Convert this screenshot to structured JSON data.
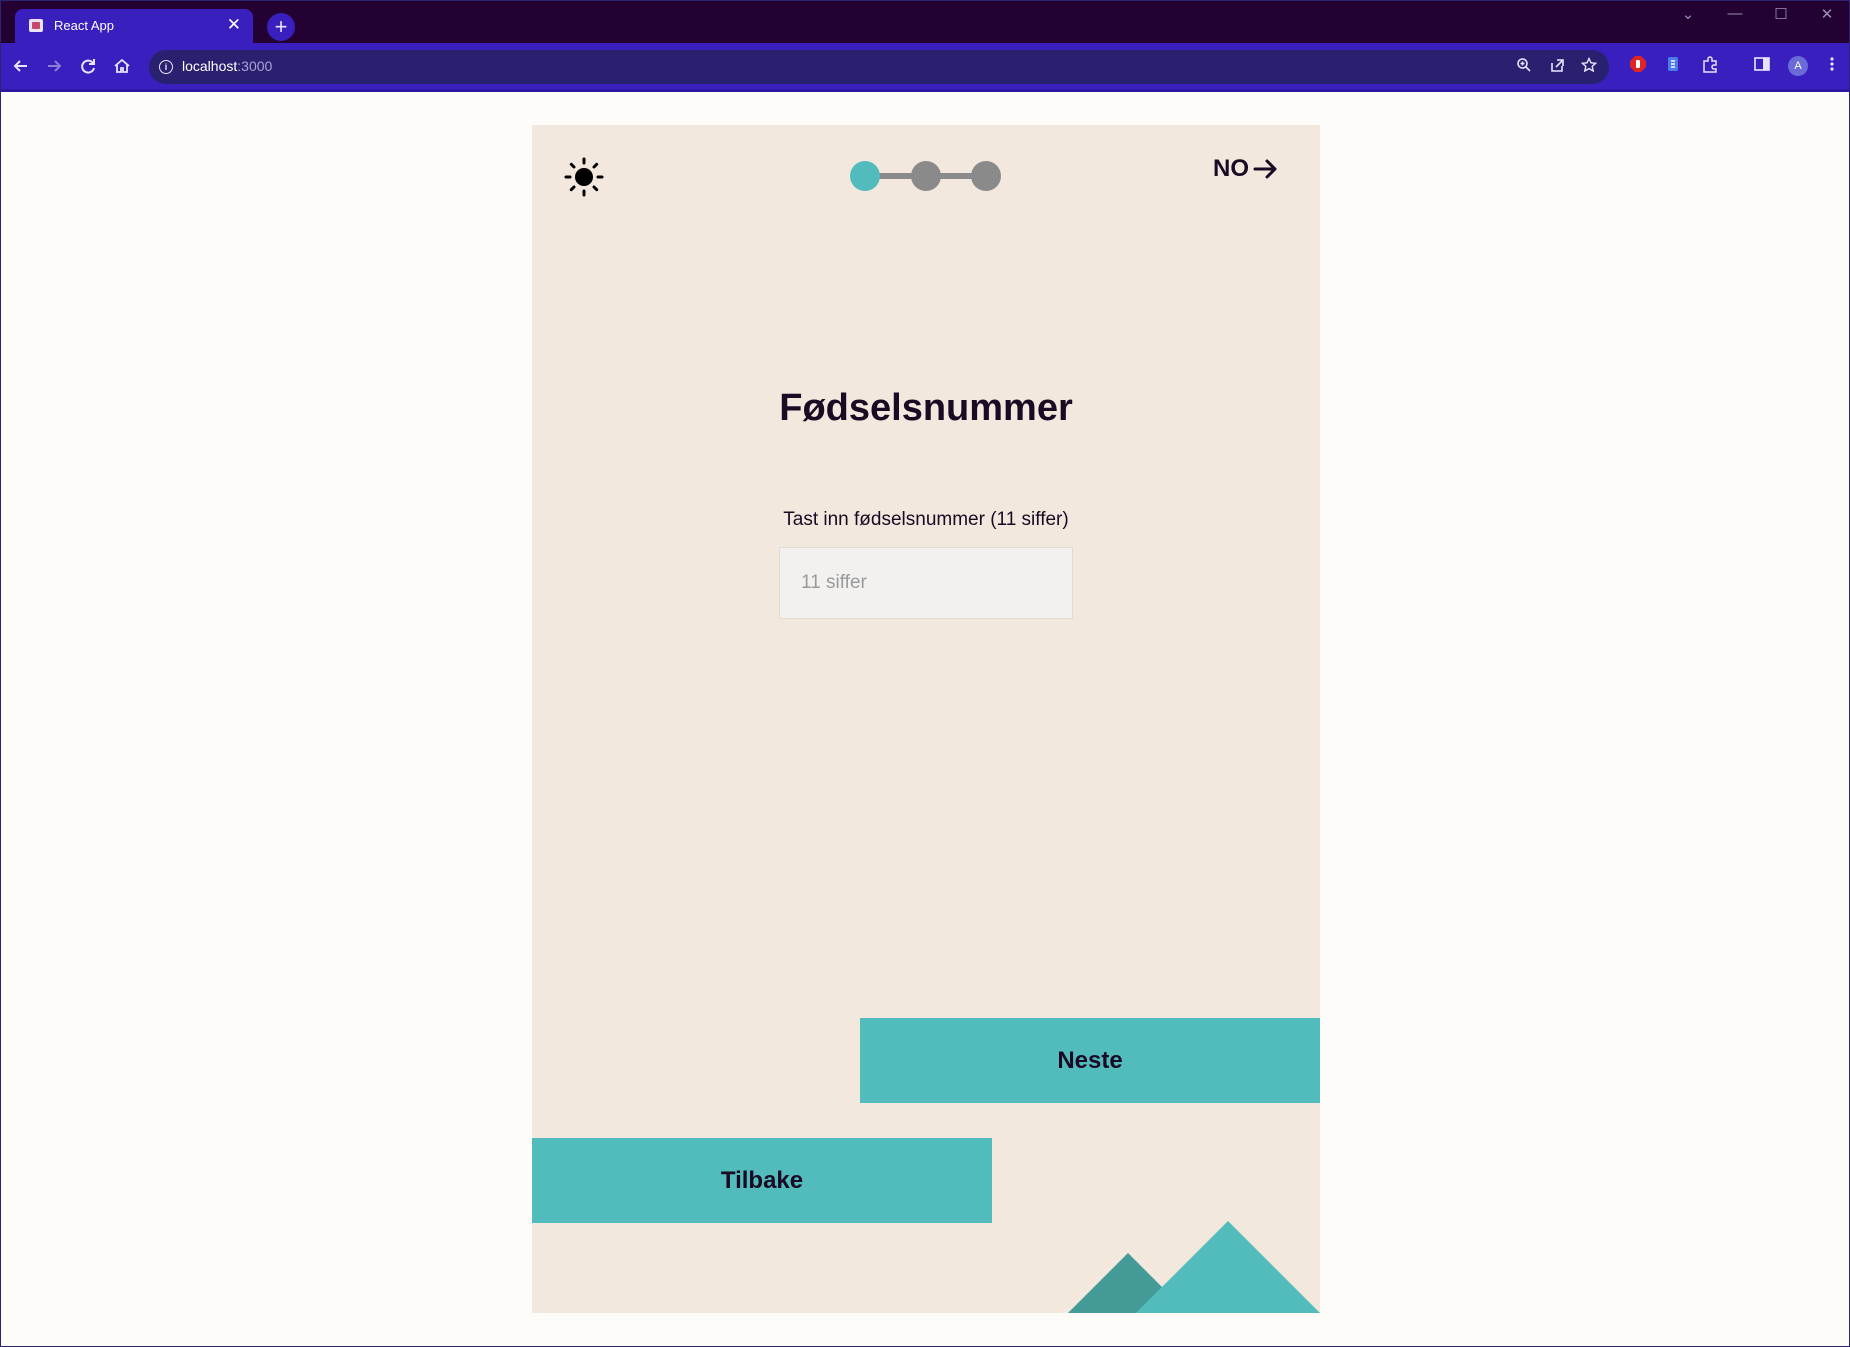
{
  "browser": {
    "tab_title": "React App",
    "tab_close": "✕",
    "new_tab": "+",
    "url_host": "localhost",
    "url_port": ":3000",
    "window_controls": [
      "⌄",
      "—",
      "☐",
      "✕"
    ]
  },
  "app": {
    "language": "NO",
    "steps": {
      "total": 3,
      "current": 1
    },
    "title": "Fødselsnummer",
    "ssn_label": "Tast inn fødselsnummer (11 siffer)",
    "ssn_value": "",
    "ssn_placeholder": "11 siffer",
    "next_label": "Neste",
    "back_label": "Tilbake",
    "colors": {
      "background": "#f2e8dd",
      "accent": "#52bcbd",
      "accent_dark": "#449a96",
      "inactive_step": "#8a8a8a",
      "text": "#1a0a24"
    }
  }
}
